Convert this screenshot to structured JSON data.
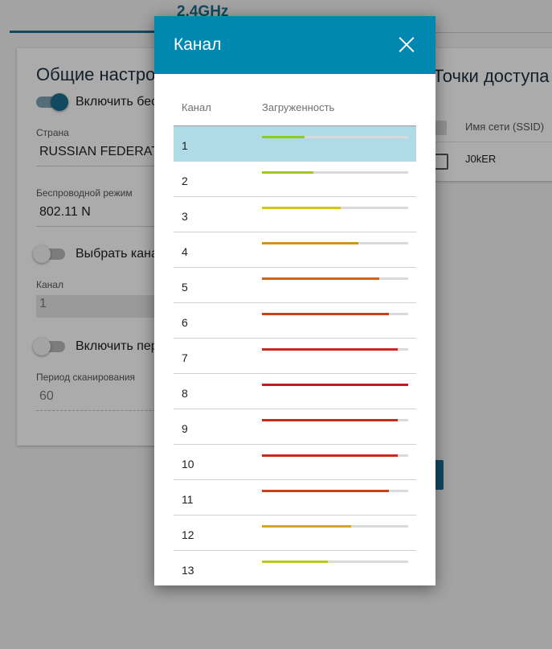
{
  "page": {
    "tab_title": "2.4GHz",
    "general": {
      "title": "Общие настройки",
      "enable_wireless_label": "Включить беспроводную сеть",
      "country_label": "Страна",
      "country_value": "RUSSIAN FEDERATION",
      "mode_label": "Беспроводной режим",
      "mode_value": "802.11 N",
      "auto_channel_label": "Выбрать канал автоматически",
      "channel_label": "Канал",
      "channel_value": "1",
      "periodic_scan_label": "Включить периодическое сканирование",
      "scan_period_label": "Период сканирования",
      "scan_period_value": "60"
    },
    "access_points": {
      "title": "Точки доступа",
      "column_ssid": "Имя сети (SSID)",
      "rows": [
        {
          "ssid": "J0kER"
        }
      ]
    }
  },
  "modal": {
    "title": "Канал",
    "close_icon": "close-icon",
    "columns": {
      "channel": "Канал",
      "load": "Загруженность"
    },
    "selected_channel": "1",
    "rows": [
      {
        "channel": "1",
        "load": 0.29,
        "color": "#8ccc1c"
      },
      {
        "channel": "2",
        "load": 0.35,
        "color": "#a4c81c"
      },
      {
        "channel": "3",
        "load": 0.54,
        "color": "#d4c41c"
      },
      {
        "channel": "4",
        "load": 0.66,
        "color": "#d4941c"
      },
      {
        "channel": "5",
        "load": 0.8,
        "color": "#cc641c"
      },
      {
        "channel": "6",
        "load": 0.87,
        "color": "#c8401c"
      },
      {
        "channel": "7",
        "load": 0.93,
        "color": "#c42c1c"
      },
      {
        "channel": "8",
        "load": 1.0,
        "color": "#c41c1c"
      },
      {
        "channel": "9",
        "load": 0.93,
        "color": "#c42c1c"
      },
      {
        "channel": "10",
        "load": 0.93,
        "color": "#c42c1c"
      },
      {
        "channel": "11",
        "load": 0.87,
        "color": "#c8401c"
      },
      {
        "channel": "12",
        "load": 0.61,
        "color": "#d4a81c"
      },
      {
        "channel": "13",
        "load": 0.45,
        "color": "#b8c81c"
      }
    ]
  }
}
